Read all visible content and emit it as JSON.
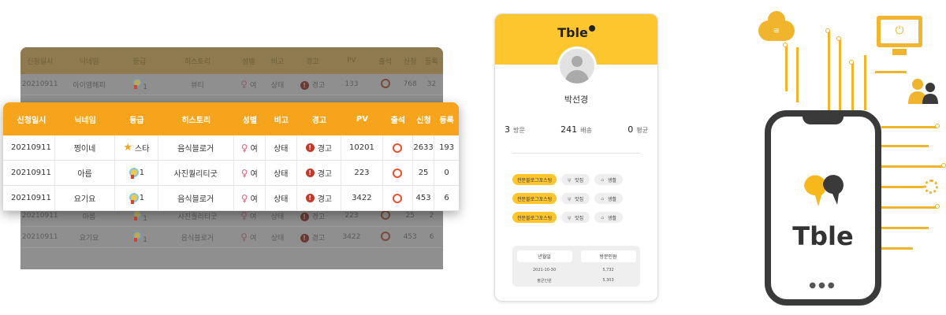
{
  "colors": {
    "accent": "#f6a41c",
    "card_yellow": "#fdc62f",
    "circuit": "#f0b42d"
  },
  "background_table": {
    "headers": [
      "신청일시",
      "닉네임",
      "등급",
      "히스토리",
      "성별",
      "비고",
      "경고",
      "PV",
      "출석",
      "신청",
      "등록"
    ],
    "rows": [
      {
        "date": "20210911",
        "nick": "아이엠해피",
        "grade": "1",
        "history": "뷰티",
        "gender": "여",
        "note": "상태",
        "warn": "경고",
        "pv": "133",
        "apply": "768",
        "reg": "32"
      },
      {
        "date": "20210911",
        "nick": "아름",
        "grade": "1",
        "history": "사진퀄리티굿",
        "gender": "여",
        "note": "상태",
        "warn": "경고",
        "pv": "223",
        "apply": "25",
        "reg": "2"
      },
      {
        "date": "20210911",
        "nick": "요기요",
        "grade": "1",
        "history": "음식블로거",
        "gender": "여",
        "note": "상태",
        "warn": "경고",
        "pv": "3422",
        "apply": "453",
        "reg": "6"
      }
    ]
  },
  "main_table": {
    "headers": [
      "신청일시",
      "닉네임",
      "등급",
      "히스토리",
      "성별",
      "비고",
      "경고",
      "PV",
      "출석",
      "신청",
      "등록"
    ],
    "rows": [
      {
        "date": "20210911",
        "nick": "찡이네",
        "grade_icon": "star-icon",
        "grade": "스타",
        "history": "음식블로거",
        "gender": "여",
        "note": "상태",
        "warn": "경고",
        "pv": "10201",
        "apply": "2633",
        "reg": "193"
      },
      {
        "date": "20210911",
        "nick": "아름",
        "grade_icon": "medal-icon",
        "grade": "1",
        "history": "사진퀄리티굿",
        "gender": "여",
        "note": "상태",
        "warn": "경고",
        "pv": "223",
        "apply": "25",
        "reg": "0"
      },
      {
        "date": "20210911",
        "nick": "요기요",
        "grade_icon": "medal-icon",
        "grade": "1",
        "history": "음식블로거",
        "gender": "여",
        "note": "상태",
        "warn": "경고",
        "pv": "3422",
        "apply": "453",
        "reg": "6"
      }
    ]
  },
  "profile_card": {
    "logo": "Tble",
    "name": "박선경",
    "stats": [
      {
        "value": "3",
        "label": "방문"
      },
      {
        "value": "241",
        "label": "배송"
      },
      {
        "value": "0",
        "label": "평균"
      }
    ],
    "tag_rows": [
      {
        "main": "전문블로그포스팅",
        "sub1": "맛집",
        "sub2": "생활"
      },
      {
        "main": "전문블로그포스팅",
        "sub1": "맛집",
        "sub2": "생활"
      },
      {
        "main": "전문블로그포스팅",
        "sub1": "맛집",
        "sub2": "생활"
      }
    ],
    "visit_table": {
      "headers": [
        "년월일",
        "방문인원"
      ],
      "rows": [
        {
          "a": "2021-10-30",
          "b": "5,732"
        },
        {
          "a": "평균인원",
          "b": "5,303"
        }
      ]
    }
  },
  "illustration": {
    "brand": "Tble",
    "icons": [
      "cloud-wifi-icon",
      "monitor-power-icon",
      "users-icon",
      "gear-icon",
      "chat-bubble-icon"
    ]
  }
}
